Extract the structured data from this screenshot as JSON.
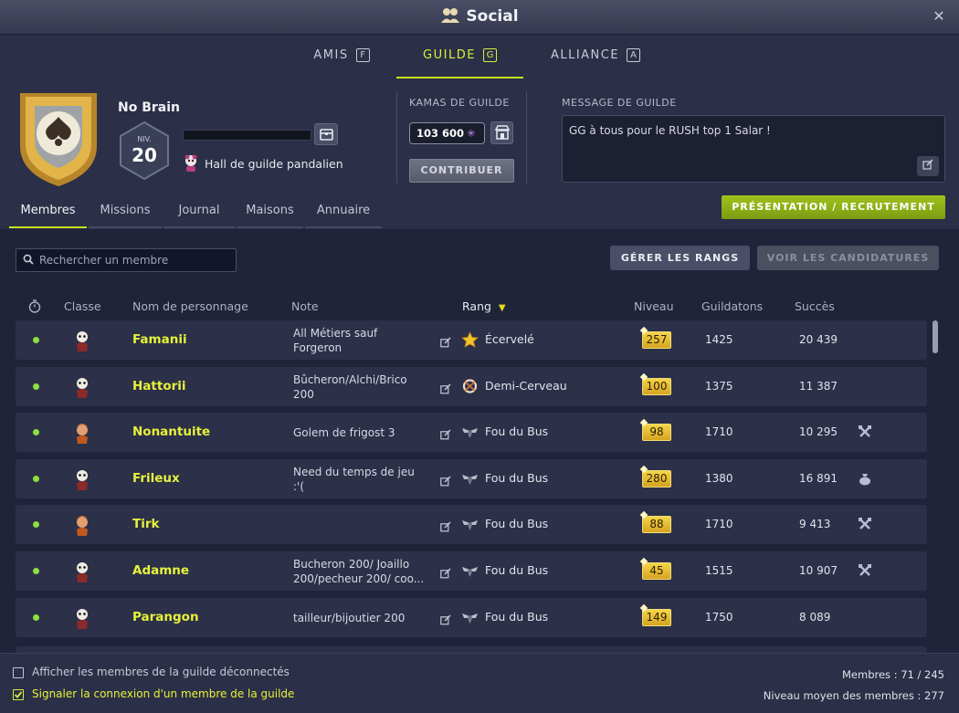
{
  "window": {
    "title": "Social",
    "close_icon": "close-icon"
  },
  "tabs": [
    {
      "label": "AMIS",
      "key": "F",
      "active": false
    },
    {
      "label": "GUILDE",
      "key": "G",
      "active": true
    },
    {
      "label": "ALLIANCE",
      "key": "A",
      "active": false
    }
  ],
  "guild": {
    "name": "No Brain",
    "level_label": "NIV.",
    "level": "20",
    "hall": "Hall de guilde pandalien",
    "kamas_label": "KAMAS DE GUILDE",
    "kamas_value": "103 600",
    "contribute_label": "CONTRIBUER",
    "message_label": "MESSAGE DE GUILDE",
    "message": "GG à tous pour le RUSH top 1 Salar !",
    "recruit_label": "PRÉSENTATION / RECRUTEMENT"
  },
  "subtabs": [
    {
      "label": "Membres",
      "active": true
    },
    {
      "label": "Missions",
      "active": false
    },
    {
      "label": "Journal",
      "active": false
    },
    {
      "label": "Maisons",
      "active": false
    },
    {
      "label": "Annuaire",
      "active": false
    }
  ],
  "search": {
    "placeholder": "Rechercher un membre"
  },
  "buttons": {
    "manage_ranks": "GÉRER LES RANGS",
    "view_applications": "VOIR LES CANDIDATURES"
  },
  "columns": {
    "class": "Classe",
    "name": "Nom de personnage",
    "note": "Note",
    "rank": "Rang",
    "level": "Niveau",
    "guildatons": "Guildatons",
    "success": "Succès"
  },
  "members": [
    {
      "name": "Famanii",
      "note": [
        "All Métiers sauf",
        "Forgeron"
      ],
      "rank": "Écervelé",
      "rank_icon": "star-icon",
      "level": "257",
      "guildatons": "1425",
      "success": "20 439",
      "extra_icon": ""
    },
    {
      "name": "Hattorii",
      "note": [
        "Bûcheron/Alchi/Brico",
        "200"
      ],
      "rank": "Demi-Cerveau",
      "rank_icon": "knot-icon",
      "level": "100",
      "guildatons": "1375",
      "success": "11 387",
      "extra_icon": ""
    },
    {
      "name": "Nonantuite",
      "note": [
        "Golem de frigost 3"
      ],
      "rank": "Fou du Bus",
      "rank_icon": "wings-icon",
      "level": "98",
      "guildatons": "1710",
      "success": "10 295",
      "extra_icon": "crossed-tools-icon"
    },
    {
      "name": "Frileux",
      "note": [
        "Need du temps de jeu",
        ":'("
      ],
      "rank": "Fou du Bus",
      "rank_icon": "wings-icon",
      "level": "280",
      "guildatons": "1380",
      "success": "16 891",
      "extra_icon": "bag-icon"
    },
    {
      "name": "Tirk",
      "note": [
        ""
      ],
      "rank": "Fou du Bus",
      "rank_icon": "wings-icon",
      "level": "88",
      "guildatons": "1710",
      "success": "9 413",
      "extra_icon": "crossed-tools-icon"
    },
    {
      "name": "Adamne",
      "note": [
        "Bucheron 200/ Joaillo",
        "200/pecheur 200/ coo..."
      ],
      "rank": "Fou du Bus",
      "rank_icon": "wings-icon",
      "level": "45",
      "guildatons": "1515",
      "success": "10 907",
      "extra_icon": "crossed-tools-icon"
    },
    {
      "name": "Parangon",
      "note": [
        "tailleur/bijoutier 200"
      ],
      "rank": "Fou du Bus",
      "rank_icon": "wings-icon",
      "level": "149",
      "guildatons": "1750",
      "success": "8 089",
      "extra_icon": ""
    }
  ],
  "footer": {
    "show_offline": "Afficher les membres de la guilde déconnectés",
    "notify_login": "Signaler la connexion d'un membre de la guilde",
    "members_count": "Membres : 71 / 245",
    "avg_level": "Niveau moyen des membres : 277"
  },
  "colors": {
    "accent": "#d8f03a",
    "online": "#8ee03e",
    "recruit": "#8fb019",
    "background": "#272b42"
  }
}
